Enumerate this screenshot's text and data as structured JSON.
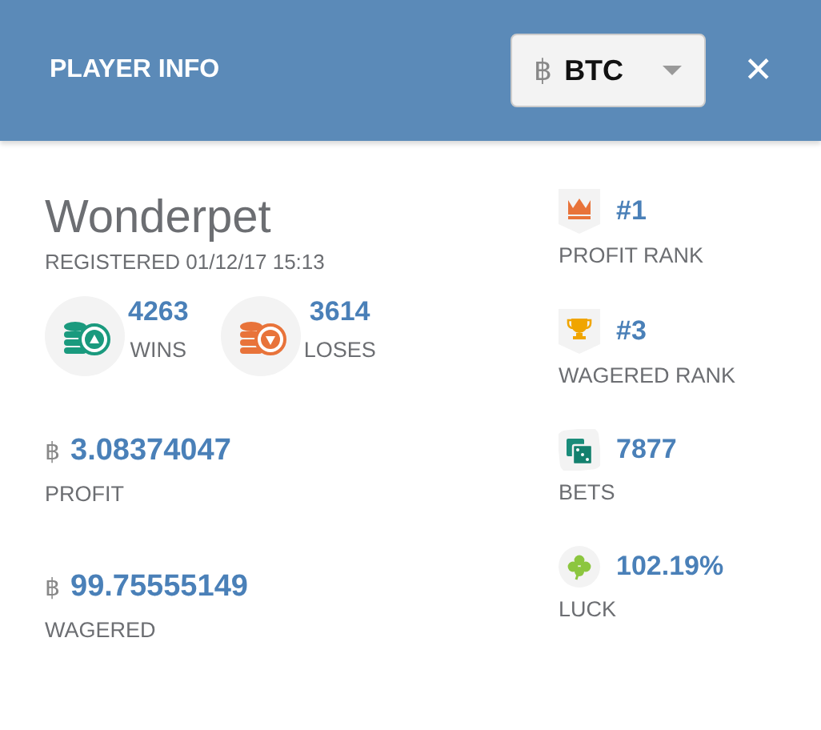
{
  "header": {
    "title": "PLAYER INFO",
    "currency": {
      "symbol": "฿",
      "value": "BTC"
    },
    "close": "✕"
  },
  "player": {
    "name": "Wonderpet",
    "registered": "REGISTERED 01/12/17 15:13"
  },
  "record": [
    {
      "kind": "win",
      "value": "4263",
      "label": "WINS"
    },
    {
      "kind": "loss",
      "value": "3614",
      "label": "LOSES"
    }
  ],
  "amounts": [
    {
      "symbol": "฿",
      "value": "3.08374047",
      "label": "PROFIT"
    },
    {
      "symbol": "฿",
      "value": "99.75555149",
      "label": "WAGERED"
    }
  ],
  "stats": [
    {
      "kind": "crown",
      "value": "#1",
      "label": "PROFIT RANK"
    },
    {
      "kind": "trophy",
      "value": "#3",
      "label": "WAGERED RANK"
    },
    {
      "kind": "dice",
      "value": "7877",
      "label": "BETS"
    },
    {
      "kind": "clover",
      "value": "102.19%",
      "label": "LUCK"
    }
  ]
}
